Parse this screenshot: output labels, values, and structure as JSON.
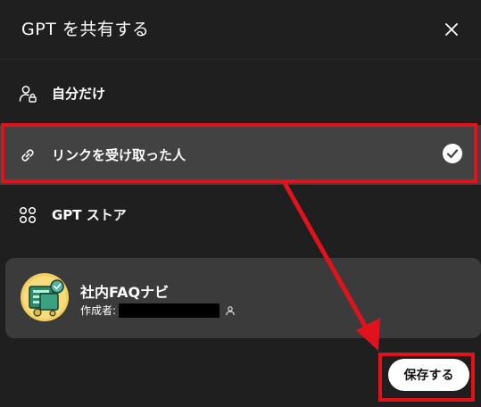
{
  "dialog": {
    "title": "GPT を共有する",
    "close_icon": "close-icon"
  },
  "options": [
    {
      "label": "自分だけ",
      "icon": "lock-person-icon",
      "selected": false
    },
    {
      "label": "リンクを受け取った人",
      "icon": "link-icon",
      "selected": true
    },
    {
      "label": "GPT ストア",
      "icon": "grid-icon",
      "selected": false
    }
  ],
  "gpt_card": {
    "name": "社内FAQナビ",
    "author_label": "作成者:"
  },
  "save_button": {
    "label": "保存する"
  },
  "annotation": {
    "color": "#e0121b"
  }
}
